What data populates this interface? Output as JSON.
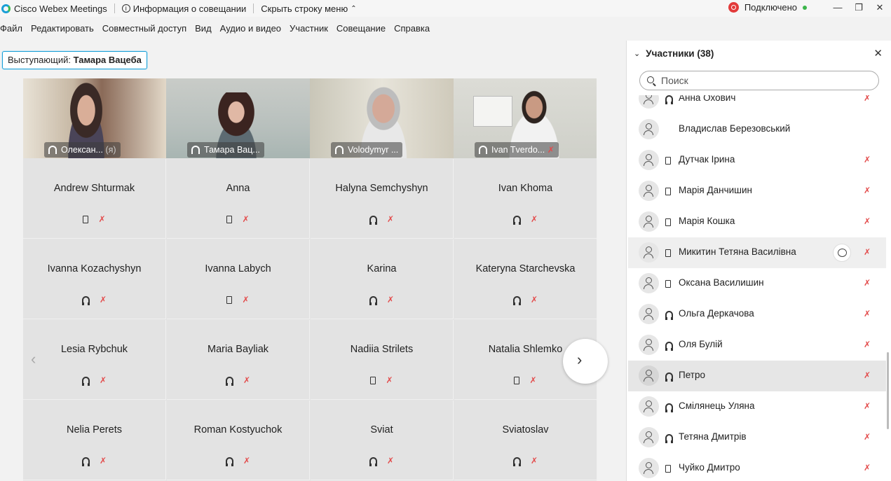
{
  "titlebar": {
    "app_name": "Cisco Webex Meetings",
    "meeting_info": "Информация о совещании",
    "hide_menu": "Скрыть строку меню",
    "status": "Подключено"
  },
  "menu": [
    "Файл",
    "Редактировать",
    "Совместный доступ",
    "Вид",
    "Аудио и видео",
    "Участник",
    "Совещание",
    "Справка"
  ],
  "speaker": {
    "prefix": "Выступающий:",
    "name": "Тамара Вацеба"
  },
  "video_tiles": [
    {
      "name": "Олексан...",
      "suffix": "(я)"
    },
    {
      "name": "Тамара Вац..."
    },
    {
      "name": "Volodymyr ..."
    },
    {
      "name": "Ivan Tverdo..."
    }
  ],
  "name_tiles": [
    {
      "name": "Andrew Shturmak",
      "device": "phone"
    },
    {
      "name": "Anna",
      "device": "phone"
    },
    {
      "name": "Halyna Semchyshyn",
      "device": "headset"
    },
    {
      "name": "Ivan Khoma",
      "device": "headset"
    },
    {
      "name": "Ivanna Kozachyshyn",
      "device": "headset"
    },
    {
      "name": "Ivanna Labych",
      "device": "phone"
    },
    {
      "name": "Karina",
      "device": "headset"
    },
    {
      "name": "Kateryna Starchevska",
      "device": "headset"
    },
    {
      "name": "Lesia Rybchuk",
      "device": "headset"
    },
    {
      "name": "Maria Bayliak",
      "device": "headset"
    },
    {
      "name": "Nadiia Strilets",
      "device": "phone"
    },
    {
      "name": "Natalia Shlemko",
      "device": "phone"
    },
    {
      "name": "Nelia Perets",
      "device": "headset"
    },
    {
      "name": "Roman Kostyuchok",
      "device": "headset"
    },
    {
      "name": "Sviat",
      "device": "headset"
    },
    {
      "name": "Sviatoslav",
      "device": "headset"
    }
  ],
  "panel": {
    "title": "Участники (38)",
    "search_placeholder": "Поиск",
    "participants": [
      {
        "name": "Анна Охович",
        "device": "headset"
      },
      {
        "name": "Владислав Березовський",
        "device": "none"
      },
      {
        "name": "Дутчак Ірина",
        "device": "phone"
      },
      {
        "name": "Марія Данчишин",
        "device": "phone"
      },
      {
        "name": "Марія Кошка",
        "device": "phone"
      },
      {
        "name": "Микитин Тетяна Василівна",
        "device": "phone"
      },
      {
        "name": "Оксана Василишин",
        "device": "phone"
      },
      {
        "name": "Ольга Деркачова",
        "device": "headset"
      },
      {
        "name": "Оля Булій",
        "device": "headset"
      },
      {
        "name": "Петро",
        "device": "headset"
      },
      {
        "name": "Смілянець Уляна",
        "device": "headset"
      },
      {
        "name": "Тетяна Дмитрів",
        "device": "headset"
      },
      {
        "name": "Чуйко Дмитро",
        "device": "phone"
      }
    ]
  },
  "colors": {
    "accent": "#1a9fd6",
    "mute": "#e34b4b",
    "connected": "#3cb54a"
  }
}
